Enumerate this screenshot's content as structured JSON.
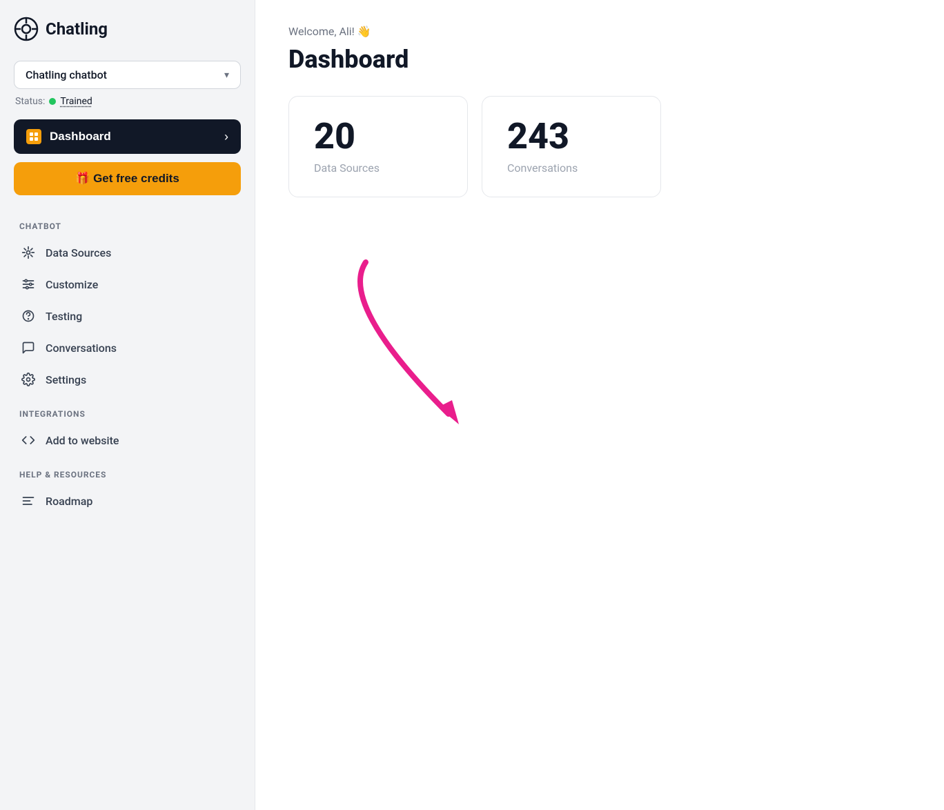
{
  "logo": {
    "text": "Chatling"
  },
  "chatbot_selector": {
    "label": "Chatling chatbot",
    "chevron": "▾"
  },
  "status": {
    "prefix": "Status:",
    "dot_color": "#22c55e",
    "value": "Trained"
  },
  "dashboard_button": {
    "label": "Dashboard",
    "arrow": "›"
  },
  "free_credits_button": {
    "label": "🎁 Get free credits"
  },
  "sections": {
    "chatbot": {
      "label": "CHATBOT",
      "items": [
        {
          "id": "data-sources",
          "icon": "plug",
          "label": "Data Sources"
        },
        {
          "id": "customize",
          "icon": "customize",
          "label": "Customize"
        },
        {
          "id": "testing",
          "icon": "testing",
          "label": "Testing"
        },
        {
          "id": "conversations",
          "icon": "conversations",
          "label": "Conversations"
        },
        {
          "id": "settings",
          "icon": "settings",
          "label": "Settings"
        }
      ]
    },
    "integrations": {
      "label": "INTEGRATIONS",
      "items": [
        {
          "id": "add-to-website",
          "icon": "code",
          "label": "Add to website"
        }
      ]
    },
    "help": {
      "label": "HELP & RESOURCES",
      "items": [
        {
          "id": "roadmap",
          "icon": "roadmap",
          "label": "Roadmap"
        }
      ]
    }
  },
  "main": {
    "welcome": "Welcome, Ali! 👋",
    "title": "Dashboard",
    "stats": [
      {
        "id": "data-sources",
        "number": "20",
        "label": "Data Sources"
      },
      {
        "id": "conversations",
        "number": "243",
        "label": "Conversations"
      }
    ]
  }
}
